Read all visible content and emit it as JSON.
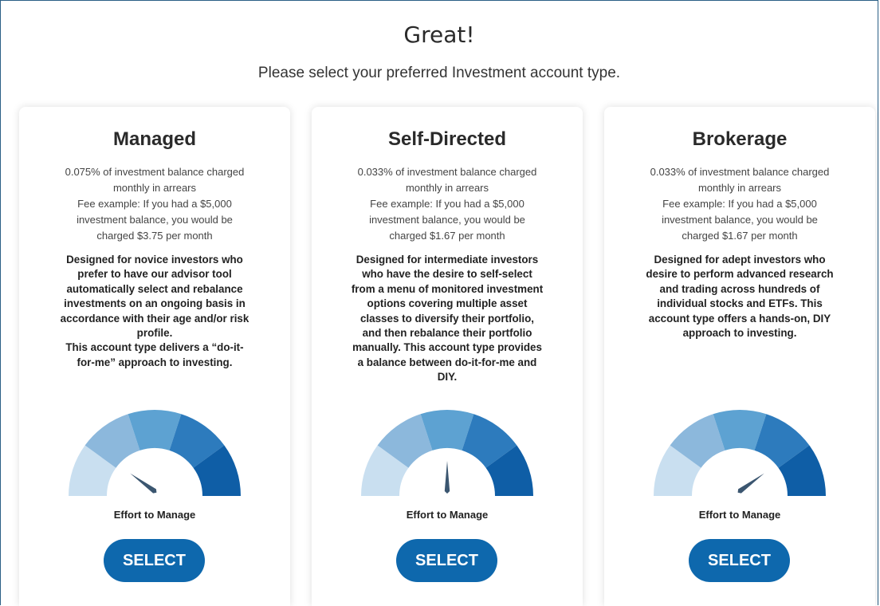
{
  "header": {
    "title": "Great!",
    "subtitle": "Please select your preferred Investment account type."
  },
  "colors": {
    "accent": "#0e68ad",
    "gauge_segments": [
      "#c9dff0",
      "#8cb8dc",
      "#5da2d2",
      "#2d7bbd",
      "#0f5ea6"
    ],
    "needle": "#3b5670"
  },
  "cards": [
    {
      "title": "Managed",
      "fee_lines": [
        "0.075% of investment balance charged",
        "monthly in arrears",
        "Fee example: If you had a $5,000",
        "investment balance, you would be",
        "charged $3.75 per month"
      ],
      "description_lines": [
        "Designed for novice investors who",
        "prefer to have our advisor tool",
        "automatically select and rebalance",
        "investments on an ongoing basis in",
        "accordance with their age and/or risk",
        "profile.",
        "This account type delivers a “do-it-",
        "for-me” approach to investing."
      ],
      "gauge_level": 0.2,
      "gauge_label": "Effort to Manage",
      "button_label": "SELECT"
    },
    {
      "title": "Self-Directed",
      "fee_lines": [
        "0.033% of investment balance charged",
        "monthly in arrears",
        "Fee example: If you had a $5,000",
        "investment balance, you would be",
        "charged $1.67 per month"
      ],
      "description_lines": [
        "Designed for intermediate investors",
        "who have the desire to self-select",
        "from a menu of monitored investment",
        "options covering multiple asset",
        "classes to diversify their portfolio,",
        "and then rebalance their portfolio",
        "manually. This account type provides",
        "a balance between do-it-for-me and",
        "DIY."
      ],
      "gauge_level": 0.5,
      "gauge_label": "Effort to Manage",
      "button_label": "SELECT"
    },
    {
      "title": "Brokerage",
      "fee_lines": [
        "0.033% of investment balance charged",
        "monthly in arrears",
        "Fee example: If you had a $5,000",
        "investment balance, you would be",
        "charged $1.67 per month"
      ],
      "description_lines": [
        "Designed for adept investors who",
        "desire to perform advanced research",
        "and trading across hundreds of",
        "individual stocks and ETFs. This",
        "account type offers a hands-on, DIY",
        "approach to investing."
      ],
      "gauge_level": 0.8,
      "gauge_label": "Effort to Manage",
      "button_label": "SELECT"
    }
  ]
}
